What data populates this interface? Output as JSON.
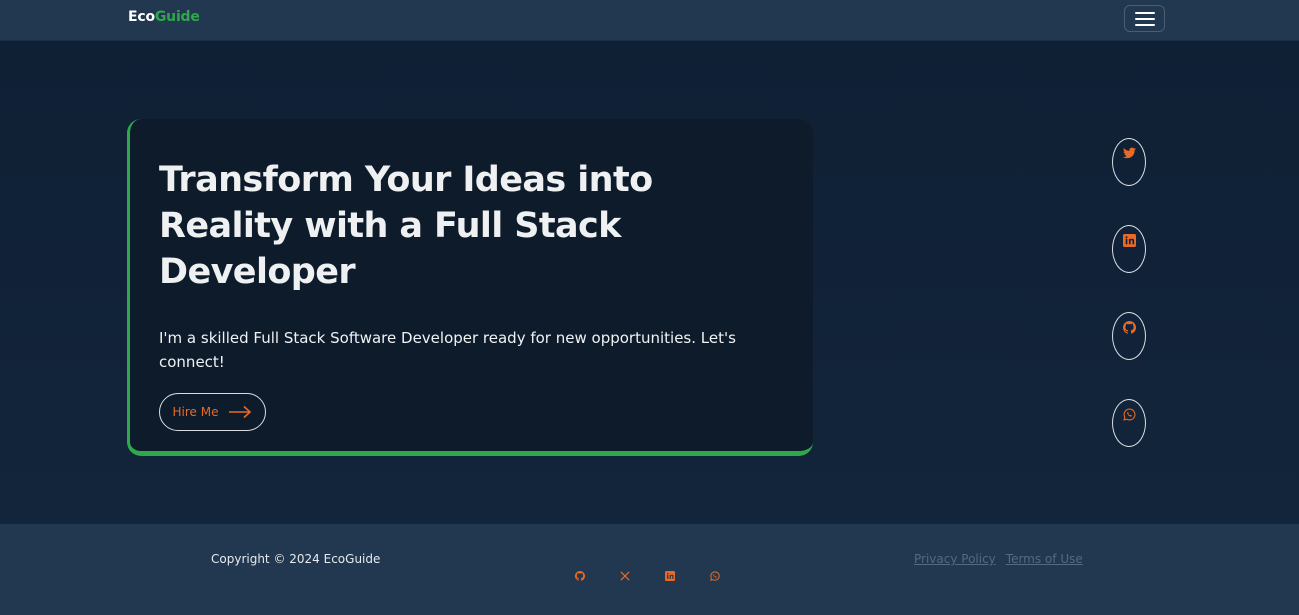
{
  "brand": {
    "part1": "Eco",
    "part2": "Guide"
  },
  "hero": {
    "headline": "Transform Your Ideas into Reality with a Full Stack Developer",
    "subtext": "I'm a skilled Full Stack Software Developer ready for new opportunities. Let's connect!",
    "cta_label": "Hire Me"
  },
  "side_social": [
    "twitter-icon",
    "linkedin-icon",
    "github-icon",
    "whatsapp-icon"
  ],
  "footer": {
    "copyright": "Copyright © 2024 EcoGuide",
    "social": [
      "github-icon",
      "x-icon",
      "linkedin-icon",
      "whatsapp-icon"
    ],
    "links": {
      "privacy": "Privacy Policy",
      "terms": "Terms of Use"
    }
  },
  "colors": {
    "accent_green": "#2ea84a",
    "accent_orange": "#e86a24",
    "nav_bg": "#223850",
    "hero_bg": "#0f2035",
    "card_bg": "#0d1b2b"
  }
}
